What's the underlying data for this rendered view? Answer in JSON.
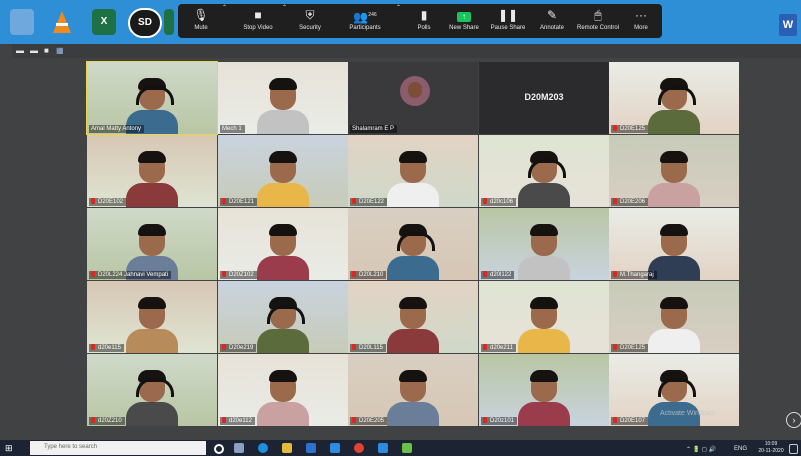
{
  "toolbar": {
    "mute": "Mute",
    "stop_video": "Stop Video",
    "security": "Security",
    "participants": "Participants",
    "participants_count": "246",
    "polls": "Polls",
    "new_share": "New Share",
    "pause_share": "Pause Share",
    "annotate": "Annotate",
    "remote_control": "Remote Control",
    "more": "More"
  },
  "desktop": {
    "sd_icon": "SD"
  },
  "tiles": [
    {
      "name": "Amal Matty Antony"
    },
    {
      "name": "Mech 1"
    },
    {
      "name": "Shalamram E P"
    },
    {
      "name": "",
      "big": "D20M203"
    },
    {
      "name": "D20E125"
    },
    {
      "name": "D20E102"
    },
    {
      "name": "D20E121"
    },
    {
      "name": "D20E122"
    },
    {
      "name": "d20c106"
    },
    {
      "name": "D20E206"
    },
    {
      "name": "D20L224 Jahnavi Vempati"
    },
    {
      "name": "D20Z102"
    },
    {
      "name": "D20L210"
    },
    {
      "name": "d20l122"
    },
    {
      "name": "M.Thangaraj"
    },
    {
      "name": "d20e115"
    },
    {
      "name": "D20e219"
    },
    {
      "name": "D20L115"
    },
    {
      "name": "d20e211"
    },
    {
      "name": "D20E125"
    },
    {
      "name": "d20Z210"
    },
    {
      "name": "d20e112"
    },
    {
      "name": "D20E205"
    },
    {
      "name": "D20z101"
    },
    {
      "name": "D20E107"
    }
  ],
  "watermark": "Activate Windows",
  "taskbar": {
    "search_placeholder": "Type here to search",
    "lang": "ENG",
    "time": "10:09",
    "date": "20-11-2020"
  },
  "colors": {
    "accent": "#2e8fd6",
    "active_speaker": "#e7d64a",
    "muted": "#e0261f",
    "new_share": "#17c45e"
  }
}
